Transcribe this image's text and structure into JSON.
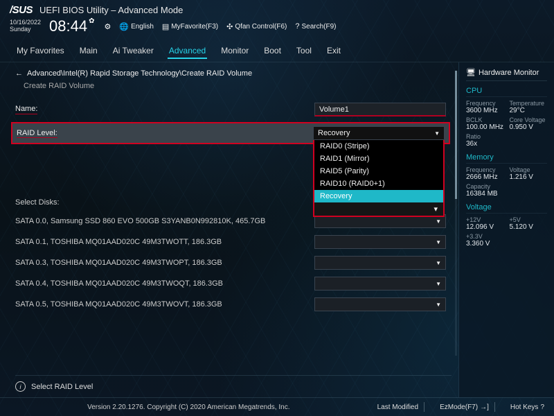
{
  "header": {
    "brand": "/SUS",
    "title": "UEFI BIOS Utility – Advanced Mode"
  },
  "datetime": {
    "date": "10/16/2022",
    "day": "Sunday",
    "time": "08:44",
    "gear": "✿"
  },
  "topbar": {
    "lang": "English",
    "fav": "MyFavorite(F3)",
    "qfan": "Qfan Control(F6)",
    "search": "Search(F9)"
  },
  "tabs": [
    "My Favorites",
    "Main",
    "Ai Tweaker",
    "Advanced",
    "Monitor",
    "Boot",
    "Tool",
    "Exit"
  ],
  "tab_active": "Advanced",
  "breadcrumb": "Advanced\\Intel(R) Rapid Storage Technology\\Create RAID Volume",
  "subtitle": "Create RAID Volume",
  "name": {
    "label": "Name:",
    "value": "Volume1"
  },
  "raid": {
    "label": "RAID Level:",
    "value": "Recovery",
    "options": [
      "RAID0 (Stripe)",
      "RAID1 (Mirror)",
      "RAID5 (Parity)",
      "RAID10 (RAID0+1)",
      "Recovery"
    ]
  },
  "disks_label": "Select Disks:",
  "disks": [
    "SATA 0.0, Samsung SSD 860 EVO 500GB S3YANB0N992810K, 465.7GB",
    "SATA 0.1, TOSHIBA MQ01AAD020C 49M3TWOTT, 186.3GB",
    "SATA 0.3, TOSHIBA MQ01AAD020C 49M3TWOPT, 186.3GB",
    "SATA 0.4, TOSHIBA MQ01AAD020C 49M3TWOQT, 186.3GB",
    "SATA 0.5, TOSHIBA MQ01AAD020C 49M3TWOVT, 186.3GB"
  ],
  "help": "Select RAID Level",
  "hw": {
    "title": "Hardware Monitor",
    "cpu": {
      "h": "CPU",
      "freq_k": "Frequency",
      "freq_v": "3600 MHz",
      "temp_k": "Temperature",
      "temp_v": "29°C",
      "bclk_k": "BCLK",
      "bclk_v": "100.00 MHz",
      "cv_k": "Core Voltage",
      "cv_v": "0.950 V",
      "ratio_k": "Ratio",
      "ratio_v": "36x"
    },
    "mem": {
      "h": "Memory",
      "freq_k": "Frequency",
      "freq_v": "2666 MHz",
      "volt_k": "Voltage",
      "volt_v": "1.216 V",
      "cap_k": "Capacity",
      "cap_v": "16384 MB"
    },
    "volt": {
      "h": "Voltage",
      "p12_k": "+12V",
      "p12_v": "12.096 V",
      "p5_k": "+5V",
      "p5_v": "5.120 V",
      "p33_k": "+3.3V",
      "p33_v": "3.360 V"
    }
  },
  "footer": {
    "version": "Version 2.20.1276. Copyright (C) 2020 American Megatrends, Inc.",
    "last": "Last Modified",
    "ez": "EzMode(F7)",
    "hot": "Hot Keys"
  }
}
